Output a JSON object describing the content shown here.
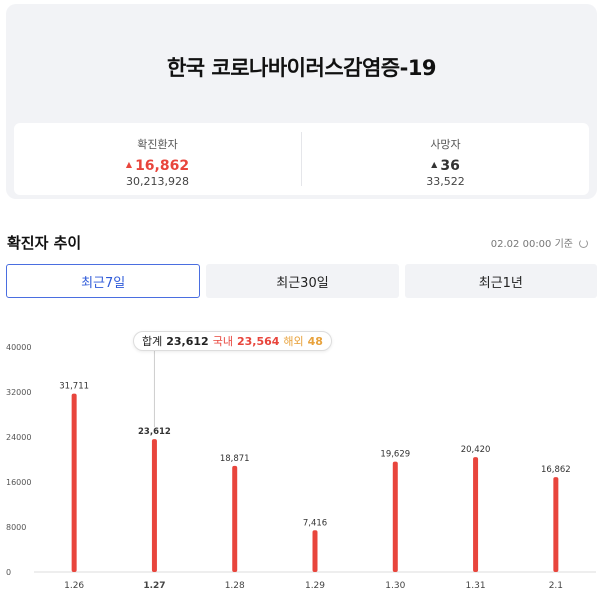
{
  "summary": {
    "title": "한국 코로나바이러스감염증-19",
    "confirmed": {
      "label": "확진환자",
      "arrow": "▲",
      "new": "16,862",
      "total": "30,213,928"
    },
    "deaths": {
      "label": "사망자",
      "arrow": "▲",
      "new": "36",
      "total": "33,522"
    }
  },
  "trend": {
    "title": "확진자 추이",
    "timestamp": "02.02 00:00 기준",
    "tabs": [
      "최근7일",
      "최근30일",
      "최근1년"
    ],
    "active_tab": 0
  },
  "tooltip": {
    "total_label": "합계",
    "total_value": "23,612",
    "domestic_label": "국내",
    "domestic_value": "23,564",
    "overseas_label": "해외",
    "overseas_value": "48"
  },
  "colors": {
    "bar": "#e8453c",
    "accent": "#2f5bd9"
  },
  "chart_data": {
    "type": "bar",
    "categories": [
      "1.26",
      "1.27",
      "1.28",
      "1.29",
      "1.30",
      "1.31",
      "2.1"
    ],
    "values": [
      31711,
      23612,
      18871,
      7416,
      19629,
      20420,
      16862
    ],
    "value_labels": [
      "31,711",
      "23,612",
      "18,871",
      "7,416",
      "19,629",
      "20,420",
      "16,862"
    ],
    "ylim": [
      0,
      40000
    ],
    "yticks": [
      0,
      8000,
      16000,
      24000,
      32000,
      40000
    ],
    "highlight_index": 1
  }
}
